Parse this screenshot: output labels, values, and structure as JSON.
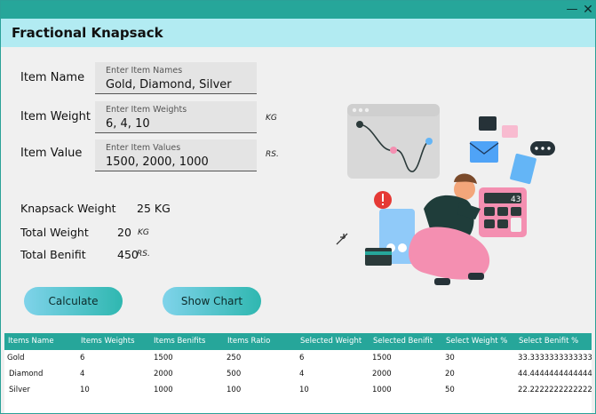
{
  "window": {
    "minimize_glyph": "—",
    "close_glyph": "✕"
  },
  "header": {
    "title": "Fractional Knapsack"
  },
  "form": {
    "item_name": {
      "label": "Item Name",
      "placeholder": "Enter Item Names",
      "value": "Gold, Diamond, Silver"
    },
    "item_weight": {
      "label": "Item Weight",
      "placeholder": "Enter Item Weights",
      "value": "6, 4, 10",
      "unit": "KG"
    },
    "item_value": {
      "label": "Item Value",
      "placeholder": "Enter Item Values",
      "value": "1500, 2000, 1000",
      "unit": "RS."
    }
  },
  "summary": {
    "knapsack_weight_label": "Knapsack Weight",
    "knapsack_weight_value": "25 KG",
    "total_weight_label": "Total Weight",
    "total_weight_value": "20",
    "total_weight_unit": "KG",
    "total_benefit_label": "Total Benifit",
    "total_benefit_value": "450",
    "total_benefit_unit": "RS."
  },
  "buttons": {
    "calculate": "Calculate",
    "show_chart": "Show Chart"
  },
  "illustration": {
    "calculator_display": "43"
  },
  "table": {
    "headers": [
      "Items Name",
      "Items Weights",
      "Items Benifits",
      "Items Ratio",
      "Selected Weight",
      "Selected Benifit",
      "Select Weight %",
      "Select Benifit %"
    ],
    "rows": [
      [
        "Gold",
        "6",
        "1500",
        "250",
        "6",
        "1500",
        "30",
        "33.3333333333333"
      ],
      [
        "Diamond",
        "4",
        "2000",
        "500",
        "4",
        "2000",
        "20",
        "44.4444444444444"
      ],
      [
        "Silver",
        "10",
        "1000",
        "100",
        "10",
        "1000",
        "50",
        "22.2222222222222"
      ]
    ]
  },
  "colors": {
    "accent": "#26a69a",
    "header_bg": "#b2ebf2",
    "button_start": "#7fd3ea",
    "button_end": "#2fb7b0"
  }
}
